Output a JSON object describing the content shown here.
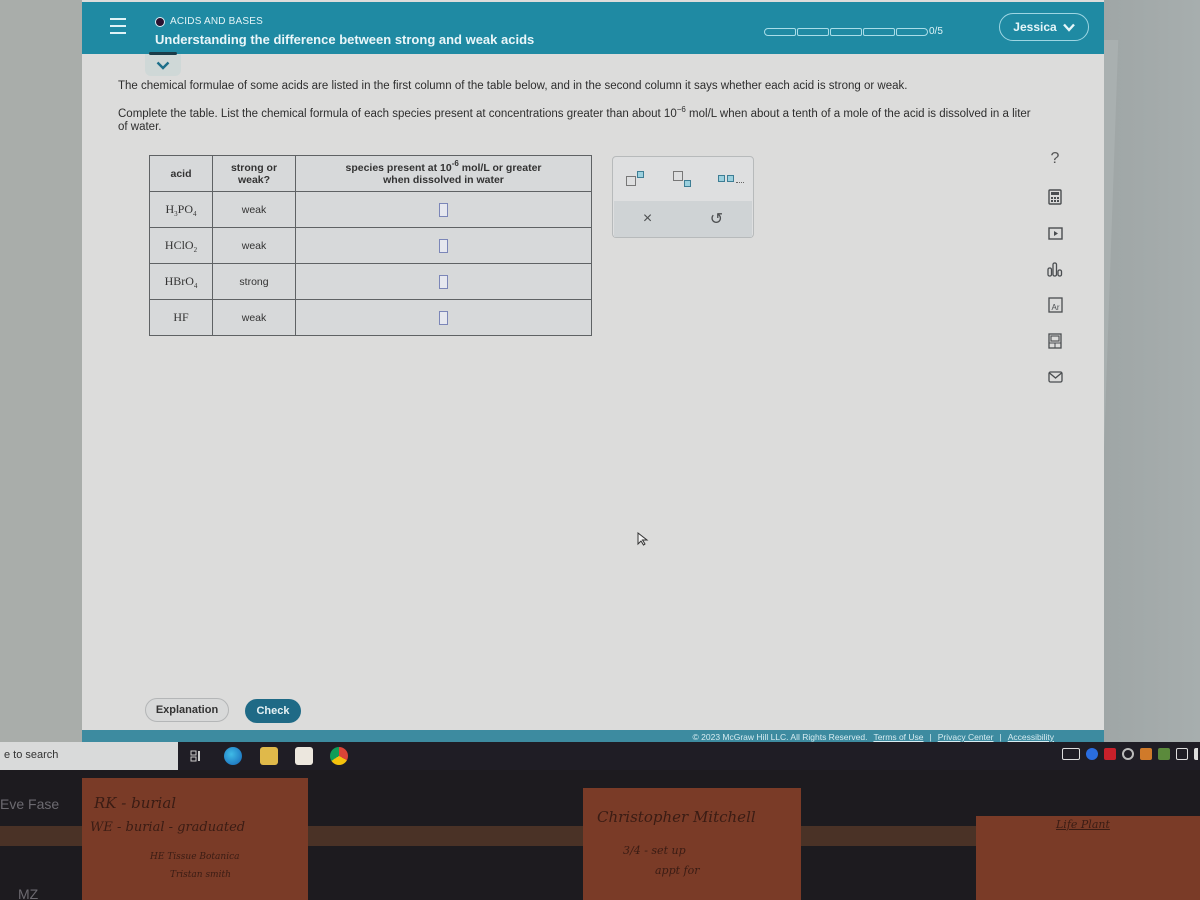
{
  "header": {
    "topic": "ACIDS AND BASES",
    "title": "Understanding the difference between strong and weak acids",
    "progress": {
      "completed": 0,
      "total": 5,
      "label": "0/5"
    },
    "user_name": "Jessica"
  },
  "prompt": {
    "intro": "The chemical formulae of some acids are listed in the first column of the table below, and in the second column it says whether each acid is strong or weak.",
    "instruction_before": "Complete the table. List the chemical formula of each species present at concentrations greater than about 10",
    "instruction_exponent": "−6",
    "instruction_after": " mol/L when about a tenth of a mole of the acid is dissolved in a liter of water."
  },
  "table": {
    "headers": {
      "acid": "acid",
      "strength_line1": "strong or",
      "strength_line2": "weak?",
      "species_line1_before": "species present at 10",
      "species_exponent": "-6",
      "species_line1_after": " mol/L or greater",
      "species_line2": "when dissolved in water"
    },
    "rows": [
      {
        "acid_parts": [
          "H",
          "3",
          "PO",
          "4"
        ],
        "strength": "weak",
        "species": ""
      },
      {
        "acid_parts": [
          "HClO",
          "2",
          "",
          ""
        ],
        "strength": "weak",
        "species": ""
      },
      {
        "acid_parts": [
          "HBrO",
          "4",
          "",
          ""
        ],
        "strength": "strong",
        "species": ""
      },
      {
        "acid_parts": [
          "HF",
          "",
          "",
          ""
        ],
        "strength": "weak",
        "species": ""
      }
    ]
  },
  "palette": {
    "buttons": [
      "superscript-icon",
      "subscript-icon",
      "list-icon"
    ],
    "clear_glyph": "×",
    "undo_glyph": "↺"
  },
  "tools": {
    "help_glyph": "?",
    "items": [
      "calculator-icon",
      "video-icon",
      "chart-icon",
      "periodic-table-icon",
      "reference-icon",
      "mail-icon"
    ]
  },
  "buttons": {
    "explanation": "Explanation",
    "check": "Check"
  },
  "footer": {
    "copyright": "© 2023 McGraw Hill LLC. All Rights Reserved.",
    "terms": "Terms of Use",
    "privacy": "Privacy Center",
    "accessibility": "Accessibility",
    "separator": "|"
  },
  "taskbar": {
    "search_placeholder": "e to search"
  },
  "desk": {
    "left_label": "Eve Fase",
    "bottom_label": "MZ",
    "note1": [
      "RK - burial",
      "WE - burial - graduated",
      "HE Tissue Botanica",
      "Tristan smith"
    ],
    "note2": [
      "Christopher Mitchell",
      "3/4 - set up",
      "appt for"
    ],
    "note3": [
      "Life Plant"
    ]
  }
}
